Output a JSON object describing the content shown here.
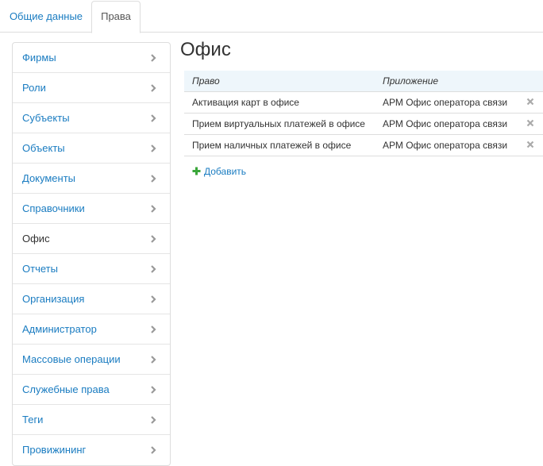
{
  "tabs": [
    {
      "label": "Общие данные",
      "active": false
    },
    {
      "label": "Права",
      "active": true
    }
  ],
  "sidebar": {
    "items": [
      {
        "label": "Фирмы",
        "current": false
      },
      {
        "label": "Роли",
        "current": false
      },
      {
        "label": "Субъекты",
        "current": false
      },
      {
        "label": "Объекты",
        "current": false
      },
      {
        "label": "Документы",
        "current": false
      },
      {
        "label": "Справочники",
        "current": false
      },
      {
        "label": "Офис",
        "current": true
      },
      {
        "label": "Отчеты",
        "current": false
      },
      {
        "label": "Организация",
        "current": false
      },
      {
        "label": "Администратор",
        "current": false
      },
      {
        "label": "Массовые операции",
        "current": false
      },
      {
        "label": "Служебные права",
        "current": false
      },
      {
        "label": "Теги",
        "current": false
      },
      {
        "label": "Провижининг",
        "current": false
      }
    ],
    "chevron_icon": "chevron-right-icon"
  },
  "main": {
    "title": "Офис",
    "table": {
      "headers": {
        "right": "Право",
        "app": "Приложение"
      },
      "rows": [
        {
          "right": "Активация карт в офисе",
          "app": "АРМ Офис оператора связи"
        },
        {
          "right": "Прием виртуальных платежей в офисе",
          "app": "АРМ Офис оператора связи"
        },
        {
          "right": "Прием наличных платежей в офисе",
          "app": "АРМ Офис оператора связи"
        }
      ],
      "delete_icon": "close-icon"
    },
    "add_label": "Добавить",
    "add_icon": "plus-icon"
  },
  "colors": {
    "link": "#1a7cc1",
    "text": "#333333",
    "header_bg": "#eef6fb",
    "add_icon": "#3aa63a",
    "delete_icon": "#aaaaaa"
  }
}
